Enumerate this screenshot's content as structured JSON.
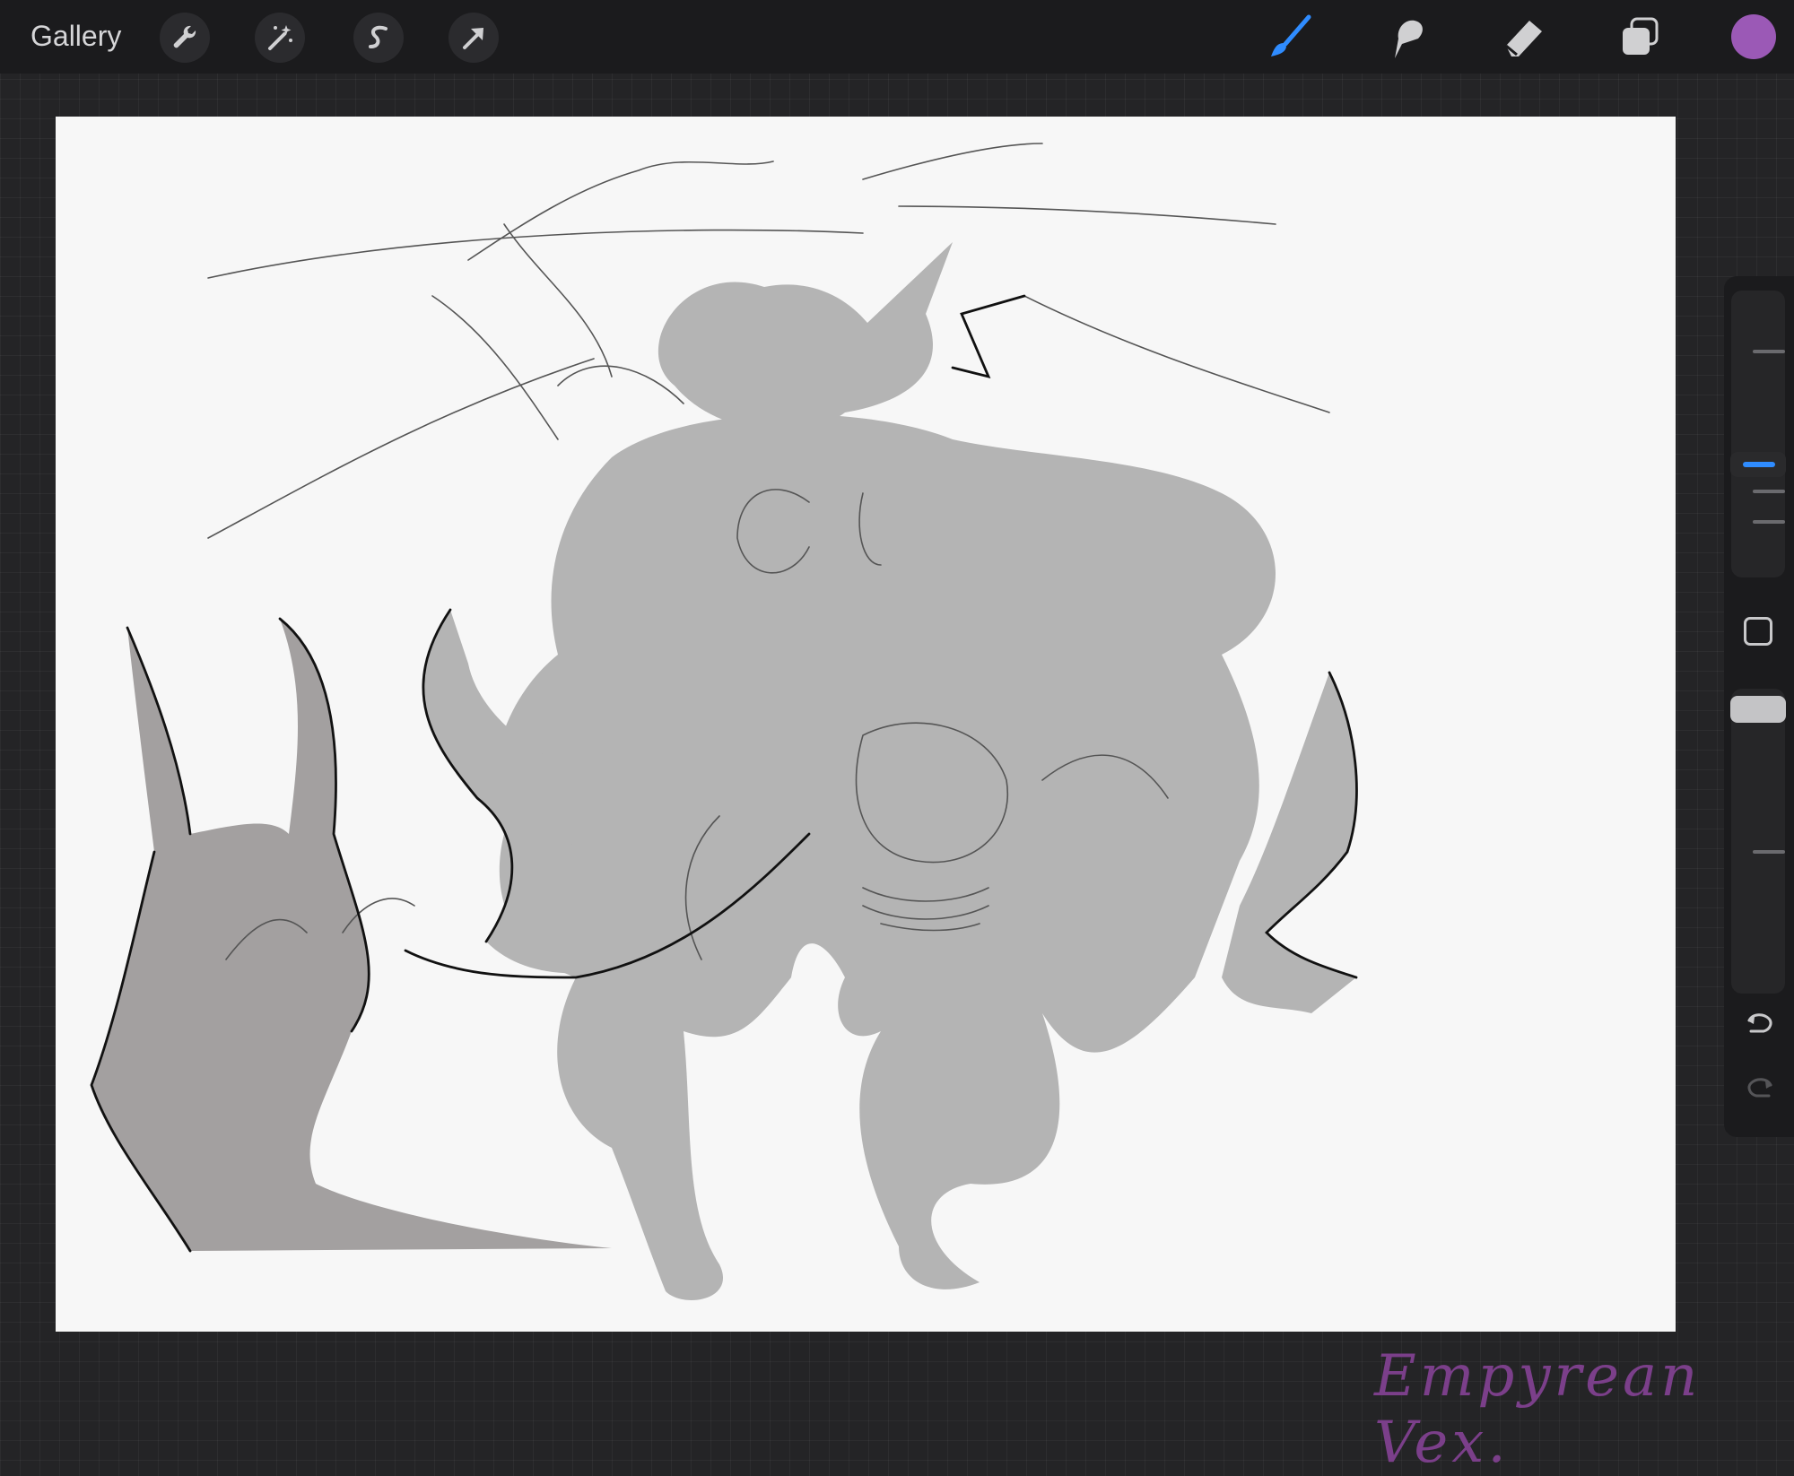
{
  "toolbar": {
    "gallery_label": "Gallery",
    "left_tools": [
      {
        "icon": "wrench-icon",
        "name": "actions"
      },
      {
        "icon": "magic-wand-icon",
        "name": "adjustments"
      },
      {
        "icon": "selection-s-icon",
        "name": "selection"
      },
      {
        "icon": "transform-arrow-icon",
        "name": "transform"
      }
    ],
    "right_tools": [
      {
        "icon": "brush-icon",
        "name": "paint",
        "active": true
      },
      {
        "icon": "smudge-icon",
        "name": "smudge"
      },
      {
        "icon": "eraser-icon",
        "name": "erase"
      },
      {
        "icon": "layers-icon",
        "name": "layers"
      }
    ],
    "current_color": "#9b59b6"
  },
  "canvas": {
    "signature": "Empyrean Vex.",
    "signature_color": "#7b3f8a",
    "fill_color": "#b4b4b4"
  },
  "sidebar": {
    "brush_size_level": 0.4,
    "opacity_level": 0.3,
    "accent_color": "#2f8cff"
  }
}
